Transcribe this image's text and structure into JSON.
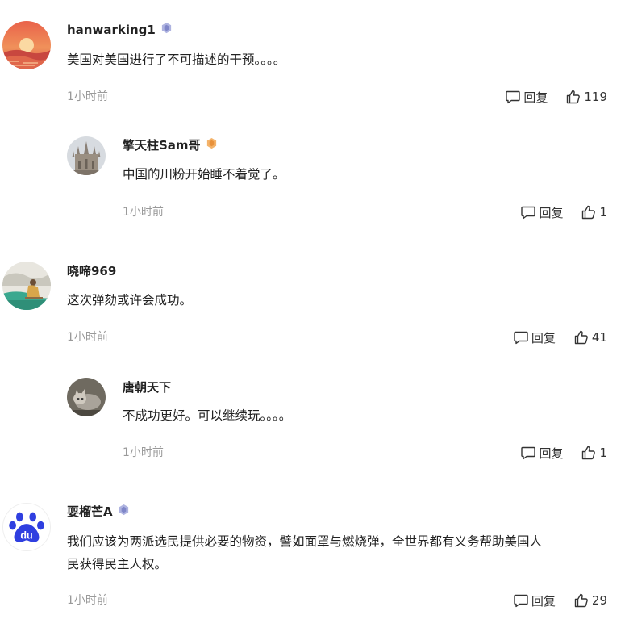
{
  "comments": [
    {
      "user": "hanwarking1",
      "badge_color": "#7f86c8",
      "avatar": "sunset-avatar",
      "text": "美国对美国进行了不可描述的干预。。。。",
      "time": "1小时前",
      "reply_label": "回复",
      "likes": "119"
    },
    {
      "user": "擎天柱Sam哥",
      "badge_color": "#e8913a",
      "avatar": "cathedral-avatar",
      "text": "中国的川粉开始睡不着觉了。",
      "time": "1小时前",
      "reply_label": "回复",
      "likes": "1"
    },
    {
      "user": "晓啼969",
      "avatar": "painting-avatar",
      "text": "这次弹劾或许会成功。",
      "time": "1小时前",
      "reply_label": "回复",
      "likes": "41"
    },
    {
      "user": "唐朝天下",
      "avatar": "cat-avatar",
      "text": "不成功更好。可以继续玩。。。。",
      "time": "1小时前",
      "reply_label": "回复",
      "likes": "1"
    },
    {
      "user": "耍榴芒A",
      "badge_color": "#7f86c8",
      "avatar": "baidu-paw-avatar",
      "avatar_text": "du",
      "text_line1": "我们应该为两派选民提供必要的物资，譬如面罩与燃烧弹，全世界都有义务帮助美国人",
      "text_line2": "民获得民主人权。",
      "time": "1小时前",
      "reply_label": "回复",
      "likes": "29"
    }
  ]
}
